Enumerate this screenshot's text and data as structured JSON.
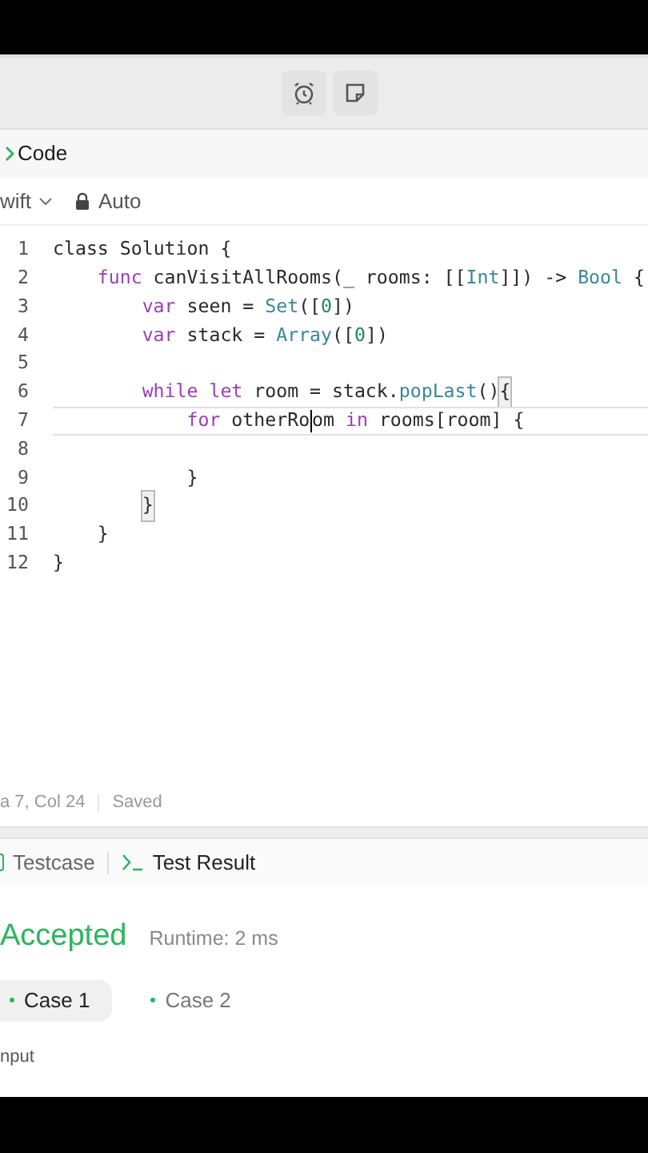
{
  "toolbar": {
    "buttons": [
      {
        "kind": "alarm"
      },
      {
        "kind": "note"
      }
    ]
  },
  "code_panel": {
    "title": "Code",
    "language": "wift",
    "mode": "Auto"
  },
  "editor": {
    "lines": [
      {
        "number": "1",
        "current": false,
        "tokens": [
          {
            "text": "class",
            "kind": "plain"
          },
          {
            "text": " Solution {",
            "kind": "plain"
          }
        ]
      },
      {
        "number": "2",
        "current": false,
        "tokens": [
          {
            "text": "func",
            "kind": "keyword"
          },
          {
            "text": " canVisitAllRooms(_ rooms: [[",
            "kind": "plain"
          },
          {
            "text": "Int",
            "kind": "type"
          },
          {
            "text": "]]) -> ",
            "kind": "plain"
          },
          {
            "text": "Bool",
            "kind": "type"
          },
          {
            "text": " {",
            "kind": "plain"
          }
        ]
      },
      {
        "number": "3",
        "current": false,
        "tokens": [
          {
            "text": "var",
            "kind": "keyword"
          },
          {
            "text": " seen = ",
            "kind": "plain"
          },
          {
            "text": "Set",
            "kind": "type"
          },
          {
            "text": "([",
            "kind": "plain"
          },
          {
            "text": "0",
            "kind": "number"
          },
          {
            "text": "])",
            "kind": "plain"
          }
        ]
      },
      {
        "number": "4",
        "current": false,
        "tokens": [
          {
            "text": "var",
            "kind": "keyword"
          },
          {
            "text": " stack = ",
            "kind": "plain"
          },
          {
            "text": "Array",
            "kind": "type"
          },
          {
            "text": "([",
            "kind": "plain"
          },
          {
            "text": "0",
            "kind": "number"
          },
          {
            "text": "])",
            "kind": "plain"
          }
        ]
      },
      {
        "number": "5",
        "current": false
      },
      {
        "number": "6",
        "current": false,
        "tokens": [
          {
            "text": "while",
            "kind": "keyword"
          },
          {
            "text": " let",
            "kind": "keyword"
          },
          {
            "text": " room = stack.",
            "kind": "plain"
          },
          {
            "text": "popLast",
            "kind": "type"
          },
          {
            "text": "()",
            "kind": "plain"
          },
          {
            "text": "{",
            "kind": "bracket"
          }
        ]
      },
      {
        "number": "7",
        "current": true,
        "tokens": [
          {
            "text": "for",
            "kind": "keyword"
          },
          {
            "text": " otherRo",
            "kind": "plain",
            "cursor": true
          },
          {
            "text": "om ",
            "kind": "plain"
          },
          {
            "text": "in",
            "kind": "keyword"
          },
          {
            "text": " rooms[room] {",
            "kind": "plain"
          }
        ]
      },
      {
        "number": "8",
        "current": false
      },
      {
        "number": "9",
        "current": false,
        "tokens": [
          {
            "text": "}",
            "kind": "plain"
          }
        ]
      },
      {
        "number": "10",
        "current": false,
        "tokens": [
          {
            "text": "}",
            "kind": "bracket"
          }
        ]
      },
      {
        "number": "11",
        "current": false,
        "tokens": [
          {
            "text": "}",
            "kind": "plain"
          }
        ]
      },
      {
        "number": "12",
        "current": false,
        "tokens": [
          {
            "text": "}",
            "kind": "plain"
          }
        ]
      }
    ]
  },
  "status_bar": {
    "position": "a 7, Col 24",
    "state": "Saved"
  },
  "result_panel": {
    "tabs": [
      {
        "label": "Testcase",
        "kind": "testcase",
        "selected": false
      },
      {
        "label": "Test Result",
        "kind": "result",
        "selected": true
      }
    ],
    "verdict": "Accepted",
    "runtime": "Runtime: 2 ms",
    "cases": [
      {
        "label": "Case 1",
        "selected": true
      },
      {
        "label": "Case 2",
        "selected": false
      }
    ],
    "input_label": "nput"
  }
}
